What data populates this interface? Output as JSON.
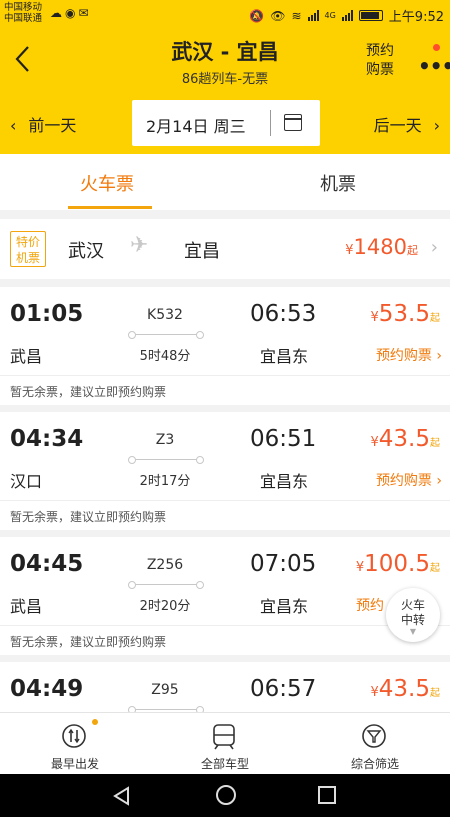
{
  "status_bar": {
    "carrier1": "中国移动",
    "carrier2": "中国联通",
    "network": "4G",
    "time": "上午9:52"
  },
  "header": {
    "title": "武汉 - 宜昌",
    "subtitle": "86趟列车-无票",
    "reserve_line1": "预约",
    "reserve_line2": "购票",
    "more": "•••"
  },
  "date_bar": {
    "prev_label": "前一天",
    "date": "2月14日 周三",
    "next_label": "后一天"
  },
  "tabs": [
    {
      "label": "火车票",
      "active": true
    },
    {
      "label": "机票",
      "active": false
    }
  ],
  "special_flight": {
    "badge_line1": "特价",
    "badge_line2": "机票",
    "from": "武汉",
    "to": "宜昌",
    "currency": "¥",
    "price": "1480",
    "suffix": "起"
  },
  "trains": [
    {
      "dep_time": "01:05",
      "train_no": "K532",
      "arr_time": "06:53",
      "dep_station": "武昌",
      "duration": "5时48分",
      "arr_station": "宜昌东",
      "currency": "¥",
      "price": "53.5",
      "suffix": "起",
      "book_label": "预约购票",
      "note": "暂无余票，建议立即预约购票"
    },
    {
      "dep_time": "04:34",
      "train_no": "Z3",
      "arr_time": "06:51",
      "dep_station": "汉口",
      "duration": "2时17分",
      "arr_station": "宜昌东",
      "currency": "¥",
      "price": "43.5",
      "suffix": "起",
      "book_label": "预约购票",
      "note": "暂无余票，建议立即预约购票"
    },
    {
      "dep_time": "04:45",
      "train_no": "Z256",
      "arr_time": "07:05",
      "dep_station": "武昌",
      "duration": "2时20分",
      "arr_station": "宜昌东",
      "currency": "¥",
      "price": "100.5",
      "suffix": "起",
      "book_label": "预约",
      "note": "暂无余票，建议立即预约购票"
    },
    {
      "dep_time": "04:49",
      "train_no": "Z95",
      "arr_time": "06:57",
      "currency": "¥",
      "price": "43.5",
      "suffix": "起"
    }
  ],
  "transfer_button": {
    "line1": "火车",
    "line2": "中转"
  },
  "toolbar": [
    {
      "label": "最早出发",
      "icon": "earliest-departure-icon"
    },
    {
      "label": "全部车型",
      "icon": "train-type-icon"
    },
    {
      "label": "综合筛选",
      "icon": "filter-icon"
    }
  ],
  "colors": {
    "brand_yellow": "#fdd000",
    "accent_orange": "#f27a0c",
    "price_red": "#f25a2c"
  }
}
